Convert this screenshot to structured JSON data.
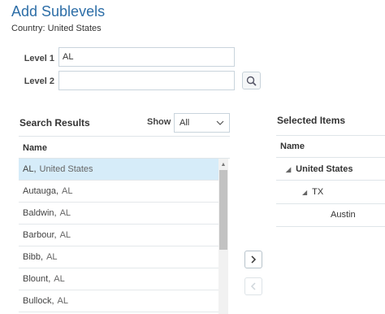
{
  "page": {
    "title": "Add Sublevels",
    "country_label": "Country: United States"
  },
  "levels": {
    "level1_label": "Level 1",
    "level1_value": "AL",
    "level2_label": "Level 2",
    "level2_value": ""
  },
  "search_results": {
    "title": "Search Results",
    "show_label": "Show",
    "show_value": "All",
    "column_name": "Name",
    "rows": [
      {
        "name": "AL,",
        "sub": "United States",
        "selected": true
      },
      {
        "name": "Autauga,",
        "sub": "AL"
      },
      {
        "name": "Baldwin,",
        "sub": "AL"
      },
      {
        "name": "Barbour,",
        "sub": "AL"
      },
      {
        "name": "Bibb,",
        "sub": "AL"
      },
      {
        "name": "Blount,",
        "sub": "AL"
      },
      {
        "name": "Bullock,",
        "sub": "AL"
      }
    ]
  },
  "selected_items": {
    "title": "Selected Items",
    "column_name": "Name",
    "tree": {
      "country": "United States",
      "state": "TX",
      "city": "Austin"
    }
  },
  "icons": {
    "search": "search-icon",
    "move_right": "chevron-right-icon",
    "move_left": "chevron-left-icon",
    "dropdown": "chevron-down-icon",
    "expanded": "triangle-expanded-icon"
  },
  "colors": {
    "title": "#2d6ea7",
    "selected_row": "#d6ecf9"
  }
}
